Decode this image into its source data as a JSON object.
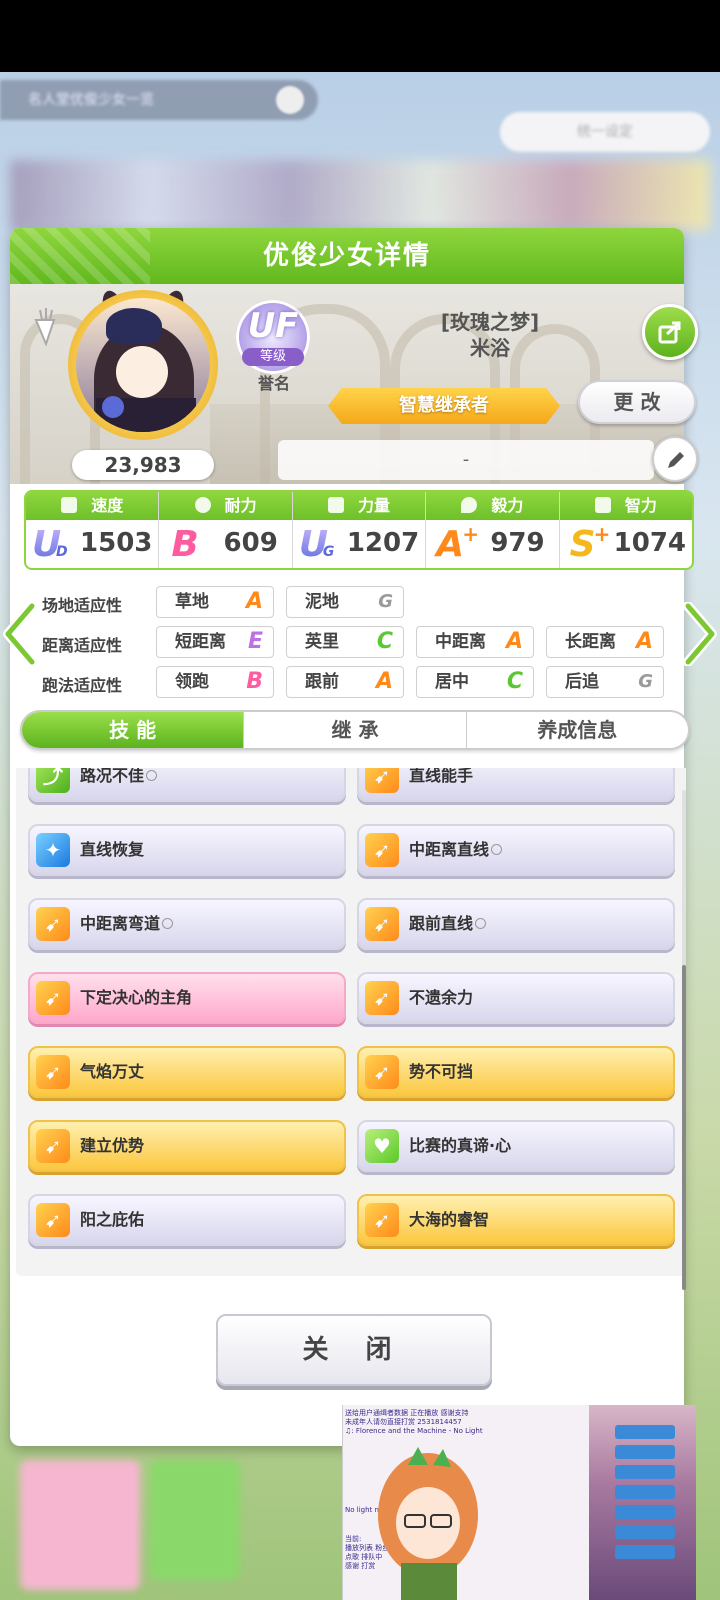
{
  "background": {
    "search_text": "名人堂优俊少女一览",
    "top_button": "统一设定"
  },
  "panel": {
    "title": "优俊少女详情",
    "fans": "23,983",
    "rank": {
      "grade": "UF",
      "level_label": "等级",
      "label": "誉名"
    },
    "character": {
      "title": "[玫瑰之梦]",
      "name": "米浴"
    },
    "honor_title": "智慧继承者",
    "change_button": "更 改",
    "name_field": "-",
    "stats": [
      {
        "label": "速度",
        "grade": "U",
        "grade_sub": "D",
        "value": "1503"
      },
      {
        "label": "耐力",
        "grade": "B",
        "grade_sub": "",
        "value": "609"
      },
      {
        "label": "力量",
        "grade": "U",
        "grade_sub": "G",
        "value": "1207"
      },
      {
        "label": "毅力",
        "grade": "A",
        "grade_sub": "+",
        "value": "979"
      },
      {
        "label": "智力",
        "grade": "S",
        "grade_sub": "+",
        "value": "1074"
      }
    ],
    "aptitude": {
      "track": {
        "label": "场地适应性",
        "items": [
          {
            "name": "草地",
            "grade": "A"
          },
          {
            "name": "泥地",
            "grade": "G"
          }
        ]
      },
      "distance": {
        "label": "距离适应性",
        "items": [
          {
            "name": "短距离",
            "grade": "E"
          },
          {
            "name": "英里",
            "grade": "C"
          },
          {
            "name": "中距离",
            "grade": "A"
          },
          {
            "name": "长距离",
            "grade": "A"
          }
        ]
      },
      "strategy": {
        "label": "跑法适应性",
        "items": [
          {
            "name": "领跑",
            "grade": "B"
          },
          {
            "name": "跟前",
            "grade": "A"
          },
          {
            "name": "居中",
            "grade": "C"
          },
          {
            "name": "后追",
            "grade": "G"
          }
        ]
      }
    },
    "tabs": [
      "技 能",
      "继 承",
      "养成信息"
    ],
    "skills": [
      {
        "name": "路况不佳",
        "circle": true
      },
      {
        "name": "直线能手",
        "circle": false
      },
      {
        "name": "直线恢复",
        "circle": false
      },
      {
        "name": "中距离直线",
        "circle": true
      },
      {
        "name": "中距离弯道",
        "circle": true
      },
      {
        "name": "跟前直线",
        "circle": true
      },
      {
        "name": "下定决心的主角",
        "circle": false
      },
      {
        "name": "不遗余力",
        "circle": false
      },
      {
        "name": "气焰万丈",
        "circle": false
      },
      {
        "name": "势不可挡",
        "circle": false
      },
      {
        "name": "建立优势",
        "circle": false
      },
      {
        "name": "比赛的真谛·心",
        "circle": false
      },
      {
        "name": "阳之庇佑",
        "circle": false
      },
      {
        "name": "大海的睿智",
        "circle": false
      }
    ],
    "close_button": "关 闭"
  },
  "overlay": {
    "chat_lines": [
      "送给用户通缉者数据 正在播放 感谢支持",
      "未成年人请勿直接打赏 2531814457",
      "♫: Florence and the Machine - No Light",
      "No light no light",
      "当前:",
      "播放列表 粉丝团",
      "点歌 排队中",
      "感谢 打赏"
    ]
  }
}
